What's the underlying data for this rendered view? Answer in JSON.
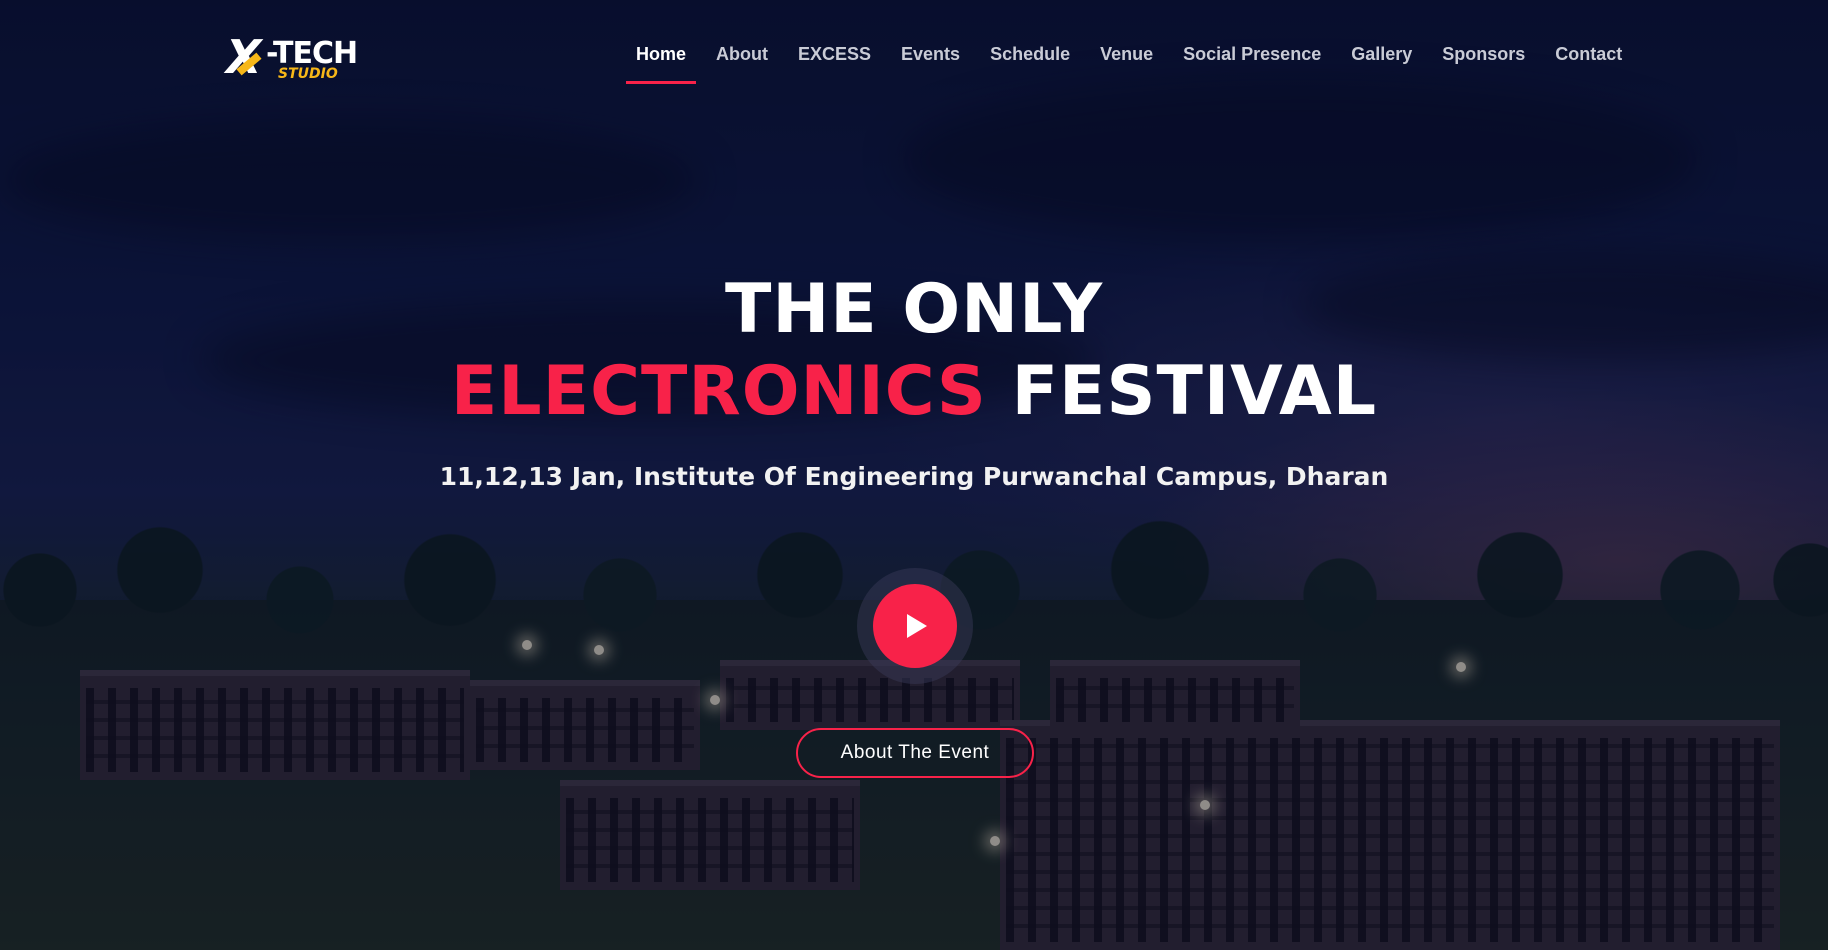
{
  "brand": {
    "logo_mark": "X",
    "logo_text": "-TECH",
    "logo_subtext": "STUDIO",
    "accent_color": "#f82249",
    "logo_accent_color": "#f7b718"
  },
  "nav": {
    "items": [
      {
        "label": "Home",
        "active": true
      },
      {
        "label": "About",
        "active": false
      },
      {
        "label": "EXCESS",
        "active": false
      },
      {
        "label": "Events",
        "active": false
      },
      {
        "label": "Schedule",
        "active": false
      },
      {
        "label": "Venue",
        "active": false
      },
      {
        "label": "Social Presence",
        "active": false
      },
      {
        "label": "Gallery",
        "active": false
      },
      {
        "label": "Sponsors",
        "active": false
      },
      {
        "label": "Contact",
        "active": false
      }
    ]
  },
  "hero": {
    "title_line1": "THE ONLY",
    "title_accent": "ELECTRONICS",
    "title_rest": " FESTIVAL",
    "subtitle": "11,12,13 Jan, Institute Of Engineering Purwanchal Campus, Dharan",
    "play_icon": "play-icon",
    "cta_label": "About The Event"
  }
}
